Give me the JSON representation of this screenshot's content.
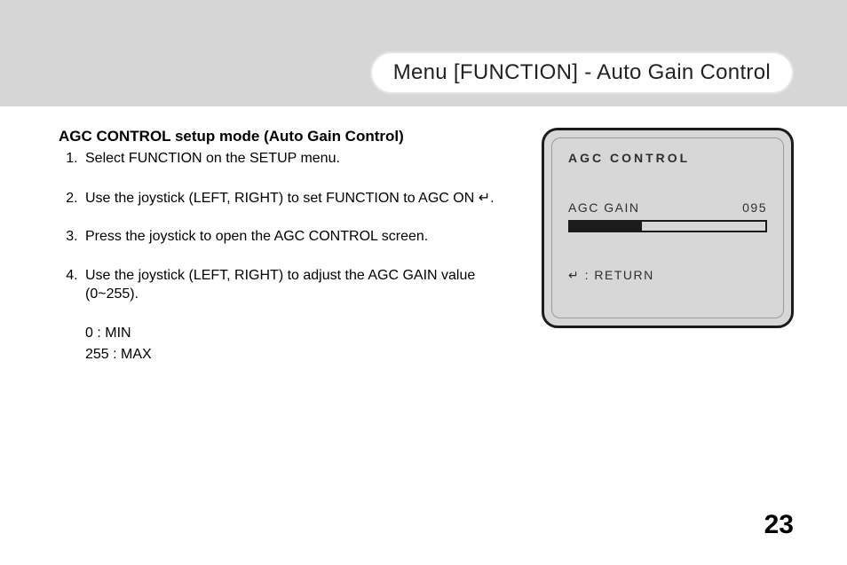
{
  "header": {
    "title": "Menu [FUNCTION] - Auto Gain Control"
  },
  "body": {
    "heading": "AGC CONTROL setup mode (Auto Gain Control)",
    "step1": "Select FUNCTION on the SETUP menu.",
    "step2_pre": "Use the joystick (LEFT, RIGHT) to set FUNCTION to AGC ON ",
    "step2_glyph": "↵",
    "step2_post": ".",
    "step3": "Press the joystick to open the AGC CONTROL screen.",
    "step4": "Use the joystick (LEFT, RIGHT) to adjust the AGC GAIN value (0~255).",
    "sub_min": "0 : MIN",
    "sub_max": "255 : MAX"
  },
  "osd": {
    "title": "AGC CONTROL",
    "param_label": "AGC GAIN",
    "param_value": "095",
    "return_glyph": "↵",
    "return_sep": " : ",
    "return_label": "RETURN"
  },
  "page_number": "23"
}
